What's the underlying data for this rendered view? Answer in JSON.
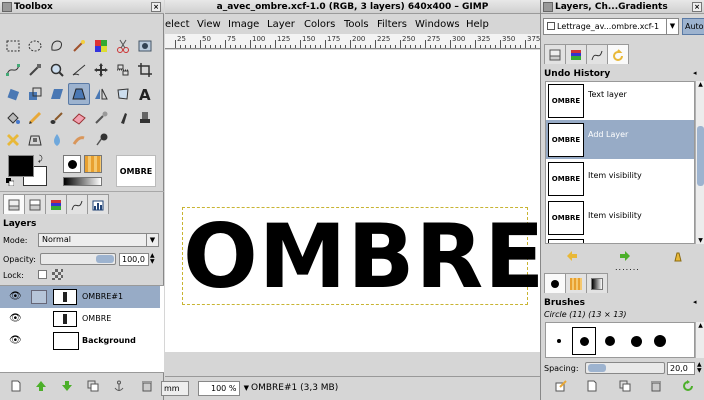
{
  "toolbox": {
    "title": "Toolbox",
    "preview_text": "OMBRE"
  },
  "layers_panel": {
    "title": "Layers",
    "mode_label": "Mode:",
    "mode_value": "Normal",
    "opacity_label": "Opacity:",
    "opacity_value": "100,0",
    "lock_label": "Lock:",
    "layers": [
      {
        "name": "OMBRE#1",
        "selected": true,
        "bold": false
      },
      {
        "name": "OMBRE",
        "selected": false,
        "bold": false
      },
      {
        "name": "Background",
        "selected": false,
        "bold": true
      }
    ]
  },
  "canvas_window": {
    "title": "a_avec_ombre.xcf-1.0 (RGB, 3 layers) 640x400 – GIMP",
    "menu": [
      "elect",
      "View",
      "Image",
      "Layer",
      "Colors",
      "Tools",
      "Filters",
      "Windows",
      "Help"
    ],
    "ruler_labels": [
      "25",
      "50",
      "75",
      "100",
      "125",
      "150",
      "175",
      "200",
      "225",
      "250",
      "275",
      "300",
      "325",
      "350",
      "375"
    ],
    "canvas_text": "OMBRE",
    "status": {
      "unit": "mm",
      "zoom": "100 %",
      "layer_info": "OMBRE#1 (3,3 MB)"
    }
  },
  "dock": {
    "title": "Layers, Ch...Gradients",
    "image_selector": "Lettrage_av...ombre.xcf-1",
    "auto_label": "Auto",
    "undo_history": {
      "title": "Undo History",
      "items": [
        {
          "label": "Text layer",
          "thumb": "OMBRE",
          "selected": false
        },
        {
          "label": "Add Layer",
          "thumb": "OMBRE",
          "selected": true
        },
        {
          "label": "Item visibility",
          "thumb": "OMBRE",
          "selected": false
        },
        {
          "label": "Item visibility",
          "thumb": "OMBRE",
          "selected": false
        }
      ]
    },
    "brushes": {
      "title": "Brushes",
      "brush_info": "Circle (11) (13 × 13)",
      "spacing_label": "Spacing:",
      "spacing_value": "20,0"
    }
  },
  "colors": {
    "selection": "#97abc6",
    "accent_green": "#4caf2a",
    "accent_yellow": "#e8b838",
    "fg_color": "#000000",
    "bg_color": "#ffffff"
  }
}
